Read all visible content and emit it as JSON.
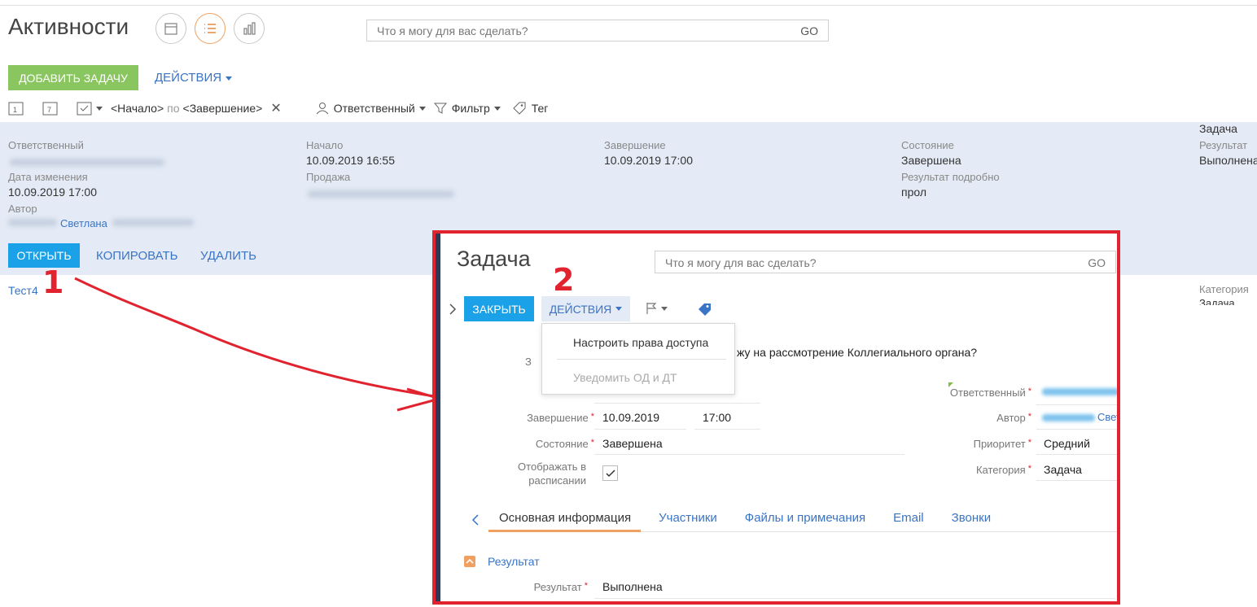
{
  "header": {
    "title": "Активности",
    "search_placeholder": "Что я могу для вас сделать?",
    "search_go": "GO"
  },
  "toolbar": {
    "add_task": "ДОБАВИТЬ ЗАДАЧУ",
    "actions": "ДЕЙСТВИЯ"
  },
  "filters": {
    "start": "<Начало>",
    "by": "по",
    "end": "<Завершение>",
    "responsible": "Ответственный",
    "filter": "Фильтр",
    "tag": "Тег"
  },
  "record": {
    "responsible_label": "Ответственный",
    "start_label": "Начало",
    "start_value": "10.09.2019 16:55",
    "end_label": "Завершение",
    "end_value": "10.09.2019 17:00",
    "state_label": "Состояние",
    "state_value": "Завершена",
    "modified_label": "Дата изменения",
    "modified_value": "10.09.2019 17:00",
    "sale_label": "Продажа",
    "result_detail_label": "Результат подробно",
    "result_detail_value": "прол",
    "author_label": "Автор",
    "author_value": "Светлана",
    "type_value": "Задача",
    "result_label": "Результат",
    "result_value": "Выполнена",
    "open": "ОТКРЫТЬ",
    "copy": "КОПИРОВАТЬ",
    "delete": "УДАЛИТЬ"
  },
  "row2": {
    "title": "Тест4",
    "category_label": "Категория",
    "category_value": "Задача"
  },
  "annotations": {
    "one": "1",
    "two": "2"
  },
  "modal": {
    "title": "Задача",
    "search_placeholder": "Что я могу для вас сделать?",
    "search_go": "GO",
    "close": "ЗАКРЫТЬ",
    "actions": "ДЕЙСТВИЯ",
    "menu": [
      "Настроить права доступа",
      "Уведомить ОД и ДТ"
    ],
    "subject_partial": "жу на рассмотрение Коллегиального органа?",
    "subject_label_partial": "З",
    "end_label": "Завершение",
    "end_date": "10.09.2019",
    "end_time": "17:00",
    "state_label": "Состояние",
    "state_value": "Завершена",
    "schedule_label": "Отображать в расписании",
    "responsible_label": "Ответственный",
    "author_label": "Автор",
    "author_partial": "Свет",
    "priority_label": "Приоритет",
    "priority_value": "Средний",
    "category_label": "Категория",
    "category_value": "Задача",
    "tabs": [
      "Основная информация",
      "Участники",
      "Файлы и примечания",
      "Email",
      "Звонки"
    ],
    "result_section": "Результат",
    "result_label": "Результат",
    "result_value": "Выполнена"
  },
  "colors": {
    "accent_blue": "#1ba1e8",
    "accent_green": "#8ac660",
    "link": "#3a74c4",
    "annotation_red": "#e0232f",
    "tab_orange": "#f0a060"
  }
}
